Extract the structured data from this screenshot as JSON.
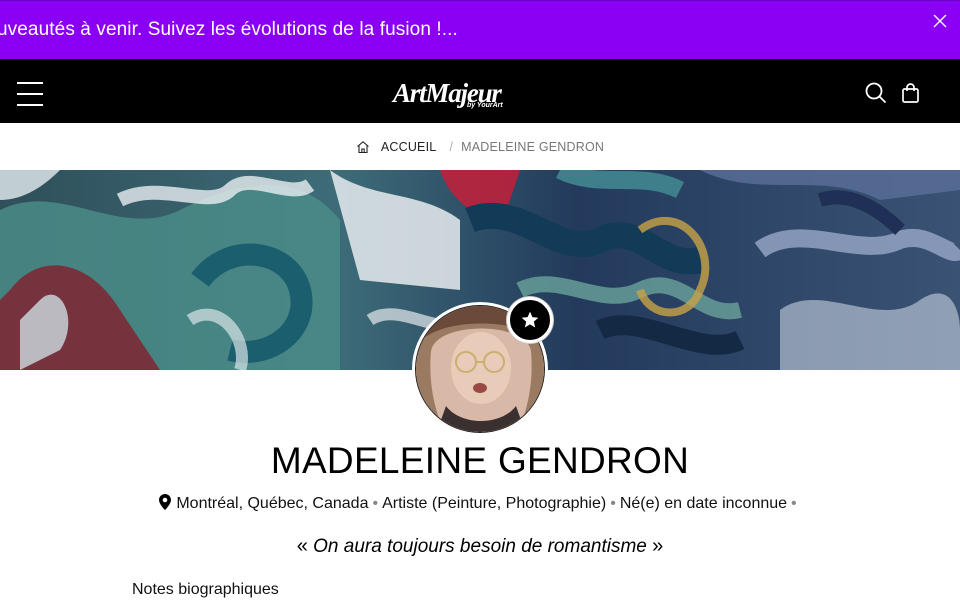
{
  "announcement": {
    "text": "uveautés à venir. Suivez les évolutions de la fusion !...",
    "background": "#8a00f5",
    "close_icon": "close-icon"
  },
  "navbar": {
    "logo_main": "ArtMajeur",
    "logo_sub": "by YourArt",
    "menu_icon": "hamburger-menu-icon",
    "search_icon": "search-icon",
    "cart_icon": "shopping-bag-icon"
  },
  "breadcrumb": {
    "home_label": "ACCUEIL",
    "separator": "/",
    "current": "MADELEINE GENDRON"
  },
  "profile": {
    "name": "MADELEINE GENDRON",
    "location": "Montréal, Québec, Canada",
    "role": "Artiste (Peinture, Photographie)",
    "birth": "Né(e) en date inconnue",
    "bullet": "•",
    "quote_open": "«",
    "quote": "On aura toujours besoin de romantisme",
    "quote_close": "»",
    "badge_icon": "star-icon"
  },
  "bio": {
    "title": "Notes biographiques"
  }
}
